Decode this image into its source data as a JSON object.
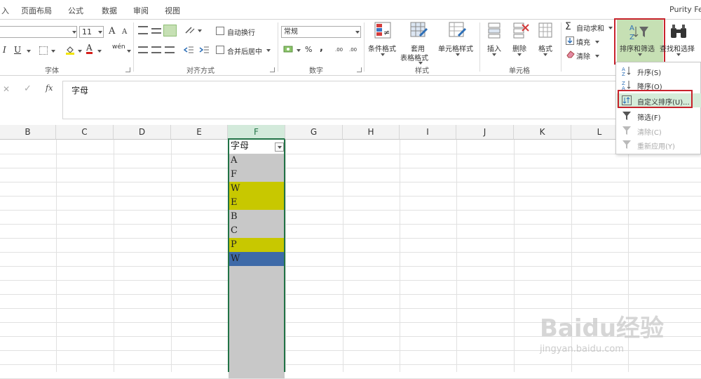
{
  "tabs": {
    "t0": "入",
    "t1": "页面布局",
    "t2": "公式",
    "t3": "数据",
    "t4": "审阅",
    "t5": "视图",
    "user": "Purity Fe"
  },
  "font": {
    "size": "11",
    "inc": "A",
    "dec": "A",
    "italic": "I",
    "underline": "U",
    "color_letter": "A",
    "phonetic": "wén",
    "group": "字体"
  },
  "align": {
    "wrap": "自动换行",
    "merge": "合并后居中",
    "group": "对齐方式"
  },
  "number": {
    "format": "常规",
    "pct": "%",
    "comma": ",",
    "inc": ".00",
    "dec": ".00",
    "group": "数字"
  },
  "styles": {
    "cond": "条件格式",
    "table1": "套用",
    "table2": "表格格式",
    "cell": "单元格样式",
    "group": "样式"
  },
  "cells": {
    "insert": "插入",
    "delete": "删除",
    "format": "格式",
    "group": "单元格"
  },
  "editing": {
    "autosum": "自动求和",
    "fill": "填充",
    "clear": "清除",
    "sort": "排序和筛选",
    "find": "查找和选择"
  },
  "formula": {
    "value": "字母"
  },
  "columns": [
    "B",
    "C",
    "D",
    "E",
    "F",
    "G",
    "H",
    "I",
    "J",
    "K",
    "L"
  ],
  "column_F_cells": [
    {
      "text": "字母",
      "bg": "#ffffff"
    },
    {
      "text": "A",
      "bg": "#c8c8c8"
    },
    {
      "text": "F",
      "bg": "#c8c8c8"
    },
    {
      "text": "W",
      "bg": "#c8c800"
    },
    {
      "text": "E",
      "bg": "#c8c800"
    },
    {
      "text": "B",
      "bg": "#c8c8c8"
    },
    {
      "text": "C",
      "bg": "#c8c8c8"
    },
    {
      "text": "P",
      "bg": "#c8c800"
    },
    {
      "text": "W",
      "bg": "#3e6aa8"
    }
  ],
  "menu": {
    "asc": "升序(S)",
    "desc": "降序(O)",
    "custom": "自定义排序(U)...",
    "filter": "筛选(F)",
    "clear": "清除(C)",
    "reapply": "重新应用(Y)"
  },
  "watermark": {
    "logo": "Baidu经验",
    "url": "jingyan.baidu.com"
  },
  "colors": {
    "highlight_red": "#c8232c",
    "grey_fill": "#c8c8c8",
    "yellow_fill": "#c8c800",
    "blue_fill": "#3e6aa8",
    "selected_col_header": "#d3eadb"
  }
}
